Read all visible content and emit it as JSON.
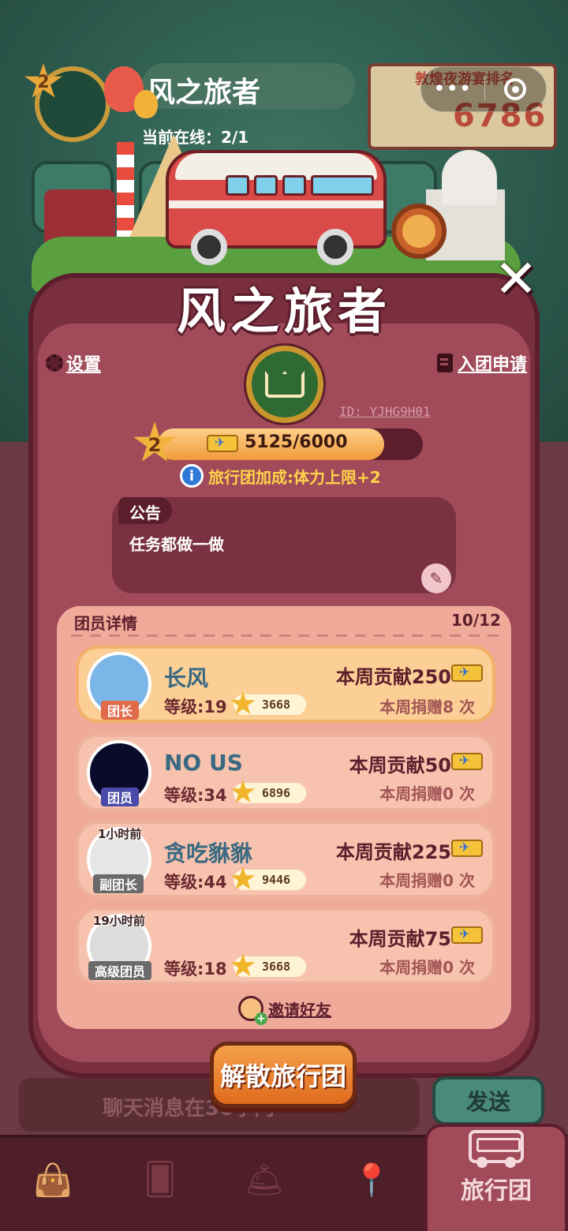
{
  "background": {
    "team_level": "2",
    "team_title": "风之旅者",
    "online_text": "当前在线：2/1",
    "rank_label": "敦煌夜游宴排名",
    "rank_value": "6786",
    "capsule_dots": "•••"
  },
  "dialog": {
    "title": "风之旅者",
    "close_label": "✕",
    "settings_label": "设置",
    "apply_label": "入团申请",
    "team_id_label": "ID:",
    "team_id": "YJHG9H01",
    "level": "2",
    "exp_text": "5125/6000",
    "exp_progress": 0.854,
    "bonus_text": "旅行团加成:体力上限+2",
    "notice_label": "公告",
    "notice_text": "任务都做一做",
    "members_title": "团员详情",
    "members_count": "10/12",
    "invite_label": "邀请好友",
    "disband_label": "解散旅行团"
  },
  "members": [
    {
      "name": "长风",
      "role": "团长",
      "online": "",
      "level_text": "等级:19",
      "stars": "3668",
      "contrib": "本周贡献250",
      "donate": "本周捐赠8 次"
    },
    {
      "name": "NO US",
      "role": "团员",
      "online": "",
      "level_text": "等级:34",
      "stars": "6896",
      "contrib": "本周贡献50",
      "donate": "本周捐赠0 次"
    },
    {
      "name": "贪吃貅貅",
      "role": "副团长",
      "online": "1小时前",
      "level_text": "等级:44",
      "stars": "9446",
      "contrib": "本周贡献225",
      "donate": "本周捐赠0 次"
    },
    {
      "name": "",
      "role": "高级团员",
      "online": "19小时前",
      "level_text": "等级:18",
      "stars": "3668",
      "contrib": "本周贡献75",
      "donate": "本周捐赠0 次"
    }
  ],
  "chat": {
    "placeholder": "聊天消息在30字内",
    "send_label": "发送"
  },
  "nav": {
    "active_label": "旅行团"
  },
  "colors": {
    "dialog_bg": "#a14b5a",
    "accent_orange": "#f29a3a",
    "name_blue": "#3a6a82",
    "bonus_yellow": "#ffd34a"
  }
}
